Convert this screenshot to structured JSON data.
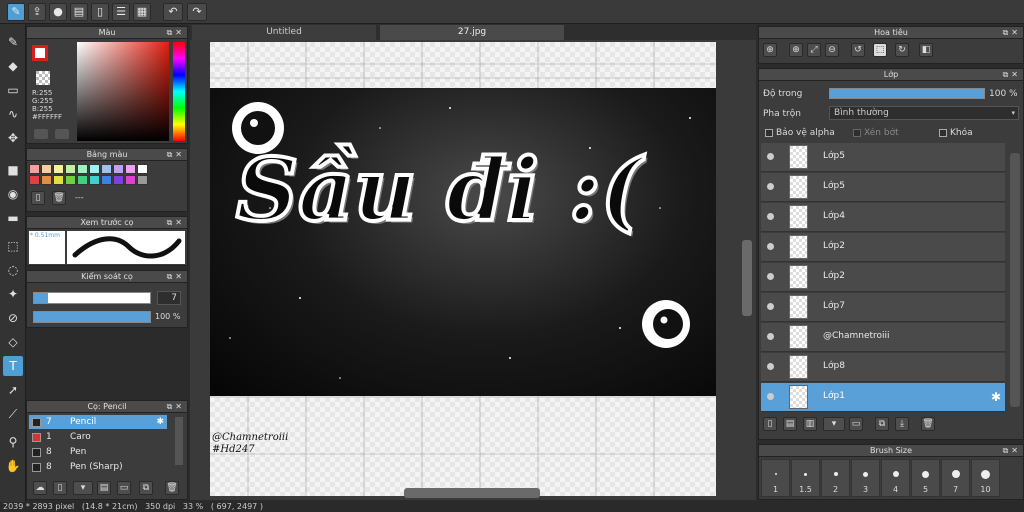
{
  "tabs": [
    {
      "label": "Untitled",
      "active": false
    },
    {
      "label": "27.jpg",
      "active": true
    }
  ],
  "color_panel": {
    "title": "Màu",
    "r": "R:255",
    "g": "G:255",
    "b": "B:255",
    "hex": "#FFFFFF"
  },
  "palette_panel": {
    "title": "Bảng màu",
    "placeholder": "---"
  },
  "brush_preview": {
    "title": "Xem trước cọ",
    "size_label": "0.51mm"
  },
  "brush_control": {
    "title": "Kiểm soát cọ",
    "size_value": "7",
    "opacity_value": "100 %"
  },
  "brush_list": {
    "title": "Cọ: Pencil",
    "items": [
      {
        "size": "7",
        "name": "Pencil",
        "color": "#222222",
        "selected": true
      },
      {
        "size": "1",
        "name": "Caro",
        "color": "#e03030",
        "selected": false
      },
      {
        "size": "8",
        "name": "Pen",
        "color": "#222222",
        "selected": false
      },
      {
        "size": "8",
        "name": "Pen (Sharp)",
        "color": "#222222",
        "selected": false
      }
    ]
  },
  "navigator": {
    "title": "Hoa tiêu"
  },
  "layer_panel": {
    "title": "Lớp",
    "opacity_label": "Độ trong",
    "opacity_value": "100 %",
    "blend_label": "Pha trộn",
    "blend_value": "Bình thường",
    "protect_alpha": "Bảo vệ alpha",
    "clip": "Xén bớt",
    "lock": "Khóa",
    "layers": [
      {
        "name": "Lớp5"
      },
      {
        "name": "Lớp5"
      },
      {
        "name": "Lớp4"
      },
      {
        "name": "Lớp2"
      },
      {
        "name": "Lớp2"
      },
      {
        "name": "Lớp7"
      },
      {
        "name": "@Chamnetroiii"
      },
      {
        "name": "Lớp8"
      },
      {
        "name": "Lớp1",
        "selected": true
      }
    ]
  },
  "brush_size_panel": {
    "title": "Brush Size",
    "sizes": [
      "1",
      "1.5",
      "2",
      "3",
      "4",
      "5",
      "7",
      "10"
    ]
  },
  "status": {
    "dimensions": "2039 * 2893 pixel",
    "physical": "(14.8 * 21cm)",
    "dpi": "350 dpi",
    "zoom": "33 %",
    "coords": "( 697, 2497 )"
  },
  "canvas": {
    "artwork_text": "Sầu đi :(",
    "watermark1": "@Chamnetroiii",
    "watermark2": "#Hd247"
  },
  "colors": {
    "accent": "#4d9fd6",
    "fg_color": "#d42020",
    "bg_color": "#ffffff"
  }
}
